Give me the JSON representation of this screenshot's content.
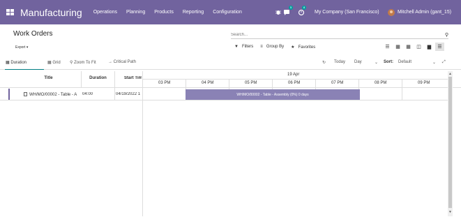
{
  "navbar": {
    "brand": "Manufacturing",
    "menu": [
      "Operations",
      "Planning",
      "Products",
      "Reporting",
      "Configuration"
    ],
    "bug_icon": "bug-icon",
    "chat_badge": "5",
    "activity_badge": "8",
    "company": "My Company (San Francisco)",
    "user": "Mitchell Admin (gant_15)",
    "accent": "#71639e"
  },
  "control_panel": {
    "title": "Work Orders",
    "export_label": "Export",
    "search_placeholder": "Search...",
    "filters_label": "Filters",
    "group_by_label": "Group By",
    "favorites_label": "Favorites",
    "views": [
      "list-icon",
      "kanban-icon",
      "calendar-icon",
      "pivot-icon",
      "graph-icon",
      "gantt-icon"
    ],
    "active_view": "gantt-icon"
  },
  "gantt_toolbar": {
    "duration": "Duration",
    "grid": "Grid",
    "zoom": "Zoom To Fit",
    "critical_path": "Critical Path",
    "today": "Today",
    "scale": "Day",
    "sort_label": "Sort:",
    "sort_value": "Default"
  },
  "grid": {
    "columns": [
      "Title",
      "Duration",
      "Start Tim"
    ],
    "date": "19 Apr",
    "hours": [
      "03 PM",
      "04 PM",
      "05 PM",
      "06 PM",
      "07 PM",
      "08 PM",
      "09 PM"
    ],
    "rows": [
      {
        "title": "WH/MO/00002 - Table - A",
        "duration": "04:00",
        "start": "04/19/2022 1",
        "bar_label": "WH/MO/00002 - Table - Assembly (0%) 0 days",
        "bar_color": "#8a82b5"
      }
    ]
  }
}
